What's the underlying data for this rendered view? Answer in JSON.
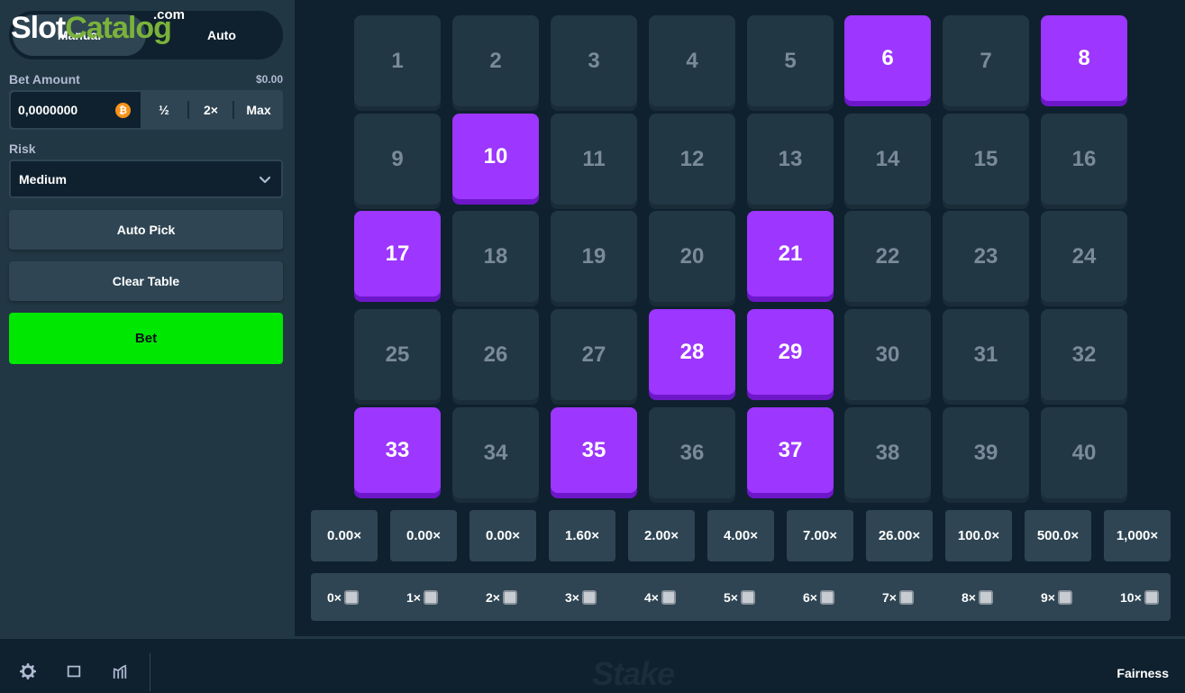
{
  "watermark": {
    "part1": "Slot",
    "part2": "Catalog",
    "part3": ".com"
  },
  "mode_toggle": {
    "manual_label": "Manual",
    "auto_label": "Auto"
  },
  "bet_amount": {
    "label": "Bet Amount",
    "usd_value": "$0.00",
    "value": "0,0000000",
    "currency_icon": "bitcoin-icon",
    "half_label": "½",
    "double_label": "2×",
    "max_label": "Max"
  },
  "risk": {
    "label": "Risk",
    "selected": "Medium"
  },
  "buttons": {
    "auto_pick": "Auto Pick",
    "clear_table": "Clear Table",
    "bet": "Bet"
  },
  "board": {
    "numbers": [
      "1",
      "2",
      "3",
      "4",
      "5",
      "6",
      "7",
      "8",
      "9",
      "10",
      "11",
      "12",
      "13",
      "14",
      "15",
      "16",
      "17",
      "18",
      "19",
      "20",
      "21",
      "22",
      "23",
      "24",
      "25",
      "26",
      "27",
      "28",
      "29",
      "30",
      "31",
      "32",
      "33",
      "34",
      "35",
      "36",
      "37",
      "38",
      "39",
      "40"
    ],
    "selected": [
      6,
      8,
      10,
      17,
      21,
      28,
      29,
      33,
      35,
      37
    ]
  },
  "multipliers": [
    "0.00×",
    "0.00×",
    "0.00×",
    "1.60×",
    "2.00×",
    "4.00×",
    "7.00×",
    "26.00×",
    "100.0×",
    "500.0×",
    "1,000×"
  ],
  "hits": [
    "0×",
    "1×",
    "2×",
    "3×",
    "4×",
    "5×",
    "6×",
    "7×",
    "8×",
    "9×",
    "10×"
  ],
  "footer": {
    "stake_logo": "Stake",
    "fairness": "Fairness"
  },
  "colors": {
    "selected_tile": "#9d36ff",
    "bet_button": "#00e701",
    "panel": "#213743",
    "background": "#0f212e"
  }
}
